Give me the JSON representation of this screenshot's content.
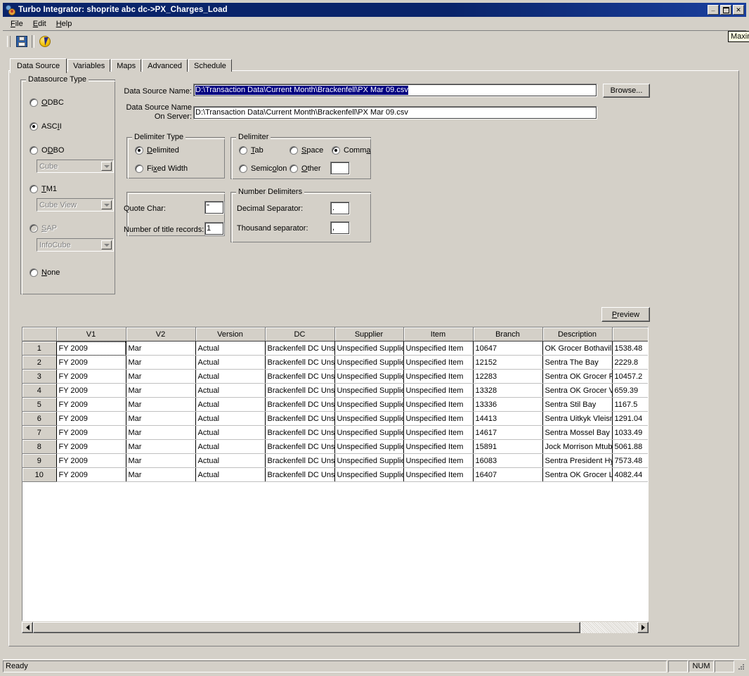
{
  "window": {
    "title": "Turbo Integrator:  shoprite abc dc->PX_Charges_Load",
    "icon": "turbo-integrator-icon",
    "minimize_label": "_",
    "maximize_label": "□",
    "close_label": "✕",
    "tooltip": "Maximize"
  },
  "menu": [
    {
      "label": "File",
      "accel": "F"
    },
    {
      "label": "Edit",
      "accel": "E"
    },
    {
      "label": "Help",
      "accel": "H"
    }
  ],
  "toolbar": {
    "save_icon": "save-floppy-icon",
    "run_icon": "lightning-bolt-icon"
  },
  "tabs": [
    {
      "label": "Data Source",
      "active": true
    },
    {
      "label": "Variables",
      "active": false
    },
    {
      "label": "Maps",
      "active": false
    },
    {
      "label": "Advanced",
      "active": false
    },
    {
      "label": "Schedule",
      "active": false
    }
  ],
  "datasource_type": {
    "title": "Datasource Type",
    "options": [
      {
        "label": "ODBC",
        "accel": "O",
        "checked": false,
        "disabled": false
      },
      {
        "label": "ASCII",
        "accel": "I",
        "checked": true,
        "disabled": false
      },
      {
        "label": "ODBO",
        "accel": "B",
        "checked": false,
        "disabled": false
      },
      {
        "label": "TM1",
        "accel": "T",
        "checked": false,
        "disabled": false
      },
      {
        "label": "SAP",
        "accel": "S",
        "checked": false,
        "disabled": true
      },
      {
        "label": "None",
        "accel": "N",
        "checked": false,
        "disabled": false
      }
    ],
    "combos": [
      {
        "value": "Cube",
        "disabled": true
      },
      {
        "value": "Cube View",
        "disabled": true
      },
      {
        "value": "InfoCube",
        "disabled": true
      }
    ]
  },
  "source": {
    "name_label": "Data Source Name:",
    "name_value": "D:\\Transaction Data\\Current Month\\Brackenfell\\PX Mar 09.csv",
    "name_selected": true,
    "server_label_line1": "Data Source Name",
    "server_label_line2": "On Server:",
    "server_value": "D:\\Transaction Data\\Current Month\\Brackenfell\\PX Mar 09.csv",
    "browse_label": "Browse..."
  },
  "delimiter_type": {
    "title": "Delimiter Type",
    "options": [
      {
        "label": "Delimited",
        "accel": "D",
        "checked": true
      },
      {
        "label": "Fixed Width",
        "accel": "x",
        "checked": false
      }
    ]
  },
  "delimiter": {
    "title": "Delimiter",
    "options": [
      {
        "label": "Tab",
        "accel": "T",
        "checked": false
      },
      {
        "label": "Space",
        "accel": "S",
        "checked": false
      },
      {
        "label": "Comma",
        "accel": "a",
        "checked": true
      },
      {
        "label": "Semicolon",
        "accel": "o",
        "checked": false
      },
      {
        "label": "Other",
        "accel": "O",
        "checked": false
      }
    ],
    "other_value": ""
  },
  "options": {
    "quote_char_label": "Quote Char:",
    "quote_char_value": "\"",
    "title_records_label": "Number of title records:",
    "title_records_value": "1"
  },
  "number_delimiters": {
    "title": "Number Delimiters",
    "decimal_label": "Decimal Separator:",
    "decimal_value": ".",
    "thousand_label": "Thousand separator:",
    "thousand_value": ","
  },
  "preview": {
    "label": "Preview",
    "accel": "P"
  },
  "grid": {
    "columns": [
      "",
      "V1",
      "V2",
      "Version",
      "DC",
      "Supplier",
      "Item",
      "Branch",
      "Description",
      ""
    ],
    "rows": [
      {
        "n": "1",
        "cells": [
          "FY 2009",
          "Mar",
          "Actual",
          "Brackenfell DC Unsp",
          "Unspecified Supplier",
          "Unspecified Item",
          "10647",
          "OK Grocer Bothaville",
          "1538.48"
        ]
      },
      {
        "n": "2",
        "cells": [
          "FY 2009",
          "Mar",
          "Actual",
          "Brackenfell DC Unsp",
          "Unspecified Supplier",
          "Unspecified Item",
          "12152",
          "Sentra The Bay",
          "2229.8"
        ]
      },
      {
        "n": "3",
        "cells": [
          "FY 2009",
          "Mar",
          "Actual",
          "Brackenfell DC Unsp",
          "Unspecified Supplier",
          "Unspecified Item",
          "12283",
          "Sentra OK Grocer P",
          "10457.2"
        ]
      },
      {
        "n": "4",
        "cells": [
          "FY 2009",
          "Mar",
          "Actual",
          "Brackenfell DC Unsp",
          "Unspecified Supplier",
          "Unspecified Item",
          "13328",
          "Sentra OK Grocer V",
          "659.39"
        ]
      },
      {
        "n": "5",
        "cells": [
          "FY 2009",
          "Mar",
          "Actual",
          "Brackenfell DC Unsp",
          "Unspecified Supplier",
          "Unspecified Item",
          "13336",
          "Sentra Stil Bay",
          "1167.5"
        ]
      },
      {
        "n": "6",
        "cells": [
          "FY 2009",
          "Mar",
          "Actual",
          "Brackenfell DC Unsp",
          "Unspecified Supplier",
          "Unspecified Item",
          "14413",
          "Sentra Uitkyk Vleism",
          "1291.04"
        ]
      },
      {
        "n": "7",
        "cells": [
          "FY 2009",
          "Mar",
          "Actual",
          "Brackenfell DC Unsp",
          "Unspecified Supplier",
          "Unspecified Item",
          "14617",
          "Sentra Mossel Bay",
          "1033.49"
        ]
      },
      {
        "n": "8",
        "cells": [
          "FY 2009",
          "Mar",
          "Actual",
          "Brackenfell DC Unsp",
          "Unspecified Supplier",
          "Unspecified Item",
          "15891",
          "Jock Morrison Mtuba",
          "5061.88"
        ]
      },
      {
        "n": "9",
        "cells": [
          "FY 2009",
          "Mar",
          "Actual",
          "Brackenfell DC Unsp",
          "Unspecified Supplier",
          "Unspecified Item",
          "16083",
          "Sentra President Hyp",
          "7573.48"
        ]
      },
      {
        "n": "10",
        "cells": [
          "FY 2009",
          "Mar",
          "Actual",
          "Brackenfell DC Unsp",
          "Unspecified Supplier",
          "Unspecified Item",
          "16407",
          "Sentra OK Grocer La",
          "4082.44"
        ]
      }
    ]
  },
  "statusbar": {
    "message": "Ready",
    "num_indicator": "NUM"
  },
  "colors": {
    "titlebar": "#0a246a",
    "face": "#d4d0c8",
    "selection": "#000080",
    "disabled_text": "#808080"
  }
}
